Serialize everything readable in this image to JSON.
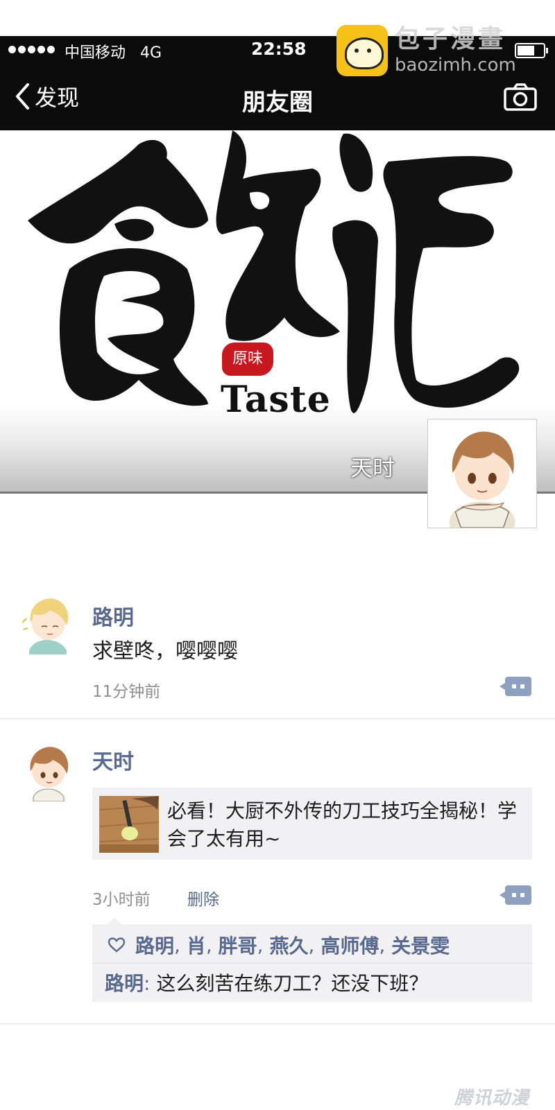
{
  "watermark": {
    "site_name": "包子漫畫",
    "url": "baozimh.com"
  },
  "status_bar": {
    "carrier": "中国移动",
    "network": "4G",
    "time": "22:58"
  },
  "nav": {
    "back_label": "发现",
    "title": "朋友圈",
    "camera_icon": "camera-icon",
    "back_icon": "chevron-left-icon"
  },
  "cover": {
    "calligraphy": "飲記",
    "seal_text": "原味",
    "taste_text": "Taste",
    "owner_name": "天时"
  },
  "posts": [
    {
      "author": "路明",
      "text": "求壁咚，嘤嘤嘤",
      "time": "11分钟前"
    },
    {
      "author": "天时",
      "link_text": "必看！大厨不外传的刀工技巧全揭秘！学会了太有用~",
      "time": "3小时前",
      "delete_label": "删除",
      "likes": [
        "路明",
        "肖",
        "胖哥",
        "燕久",
        "高师傅",
        "关景雯"
      ],
      "comments": [
        {
          "author": "路明",
          "separator": ": ",
          "text": "这么刻苦在练刀工？还没下班？"
        }
      ]
    }
  ],
  "footer_watermark": "腾讯动漫",
  "colors": {
    "header_bg": "#0b0b0b",
    "name_link": "#58688f",
    "time_gray": "#8f8f8f",
    "card_bg": "#f1f1f3",
    "more_button": "#8ea0c0",
    "seal_red": "#c7181f"
  }
}
